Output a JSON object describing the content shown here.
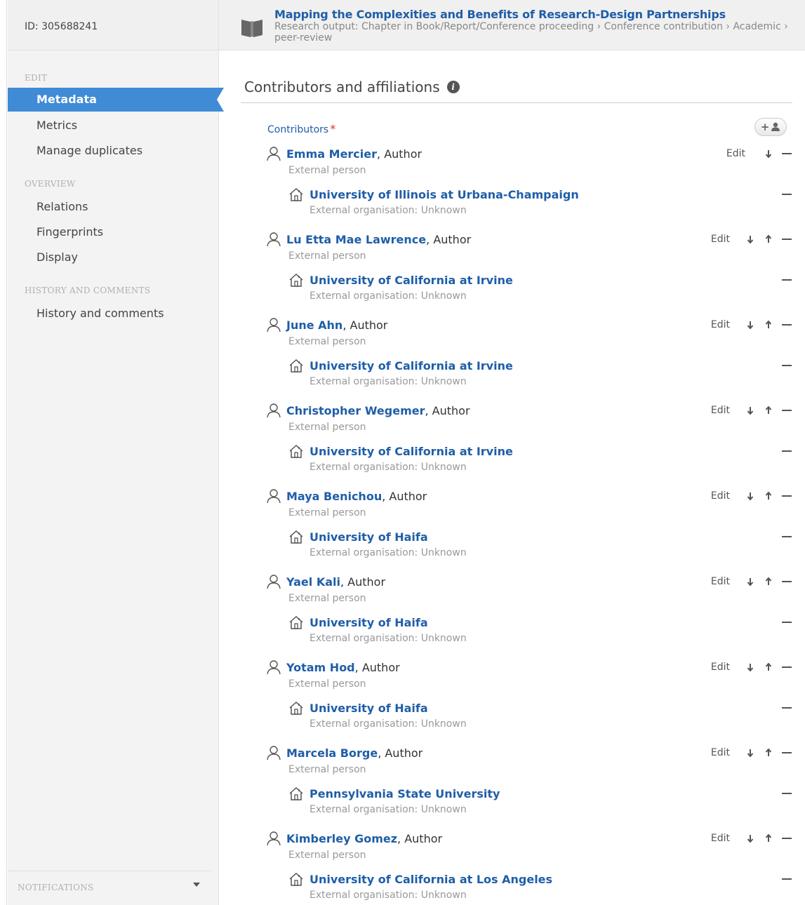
{
  "record": {
    "id": "ID: 305688241",
    "title": "Mapping the Complexities and Benefits of Research-Design Partnerships",
    "subtitle": "Research output: Chapter in Book/Report/Conference proceeding › Conference contribution › Academic › peer-review"
  },
  "sidebar": {
    "sections": [
      {
        "heading": "EDIT",
        "items": [
          "Metadata",
          "Metrics",
          "Manage duplicates"
        ]
      },
      {
        "heading": "OVERVIEW",
        "items": [
          "Relations",
          "Fingerprints",
          "Display"
        ]
      },
      {
        "heading": "HISTORY AND COMMENTS",
        "items": [
          "History and comments"
        ]
      }
    ],
    "active_item": "Metadata",
    "notifications_label": "NOTIFICATIONS"
  },
  "main": {
    "heading": "Contributors and affiliations",
    "contributors_label": "Contributors",
    "required_mark": "*",
    "edit_label": "Edit",
    "contributors": [
      {
        "name": "Emma Mercier",
        "role": ", Author",
        "person_type": "External person",
        "org": "University of Illinois at Urbana-Champaign",
        "org_type": "External organisation: Unknown"
      },
      {
        "name": "Lu Etta Mae Lawrence",
        "role": ", Author",
        "person_type": "External person",
        "org": "University of California at Irvine",
        "org_type": "External organisation: Unknown"
      },
      {
        "name": "June Ahn",
        "role": ", Author",
        "person_type": "External person",
        "org": "University of California at Irvine",
        "org_type": "External organisation: Unknown"
      },
      {
        "name": "Christopher Wegemer",
        "role": ", Author",
        "person_type": "External person",
        "org": "University of California at Irvine",
        "org_type": "External organisation: Unknown"
      },
      {
        "name": "Maya Benichou",
        "role": ", Author",
        "person_type": "External person",
        "org": "University of Haifa",
        "org_type": "External organisation: Unknown"
      },
      {
        "name": "Yael Kali",
        "role": ", Author",
        "person_type": "External person",
        "org": "University of Haifa",
        "org_type": "External organisation: Unknown"
      },
      {
        "name": "Yotam Hod",
        "role": ", Author",
        "person_type": "External person",
        "org": "University of Haifa",
        "org_type": "External organisation: Unknown"
      },
      {
        "name": "Marcela Borge",
        "role": ", Author",
        "person_type": "External person",
        "org": "Pennsylvania State University",
        "org_type": "External organisation: Unknown"
      },
      {
        "name": "Kimberley Gomez",
        "role": ", Author",
        "person_type": "External person",
        "org": "University of California at Los Angeles",
        "org_type": "External organisation: Unknown"
      }
    ]
  },
  "icons": {
    "record_type": "book-icon",
    "info": "info-icon",
    "add_person": "add-person-icon",
    "person": "person-icon",
    "organisation": "house-icon",
    "move_down": "arrow-down-icon",
    "move_up": "arrow-up-icon",
    "remove": "minus-icon",
    "notifications_toggle": "caret-down-icon"
  },
  "colors": {
    "link": "#1f5ea8",
    "active_nav": "#3f8bd6",
    "required": "#d9342b",
    "muted_text": "#999999"
  }
}
